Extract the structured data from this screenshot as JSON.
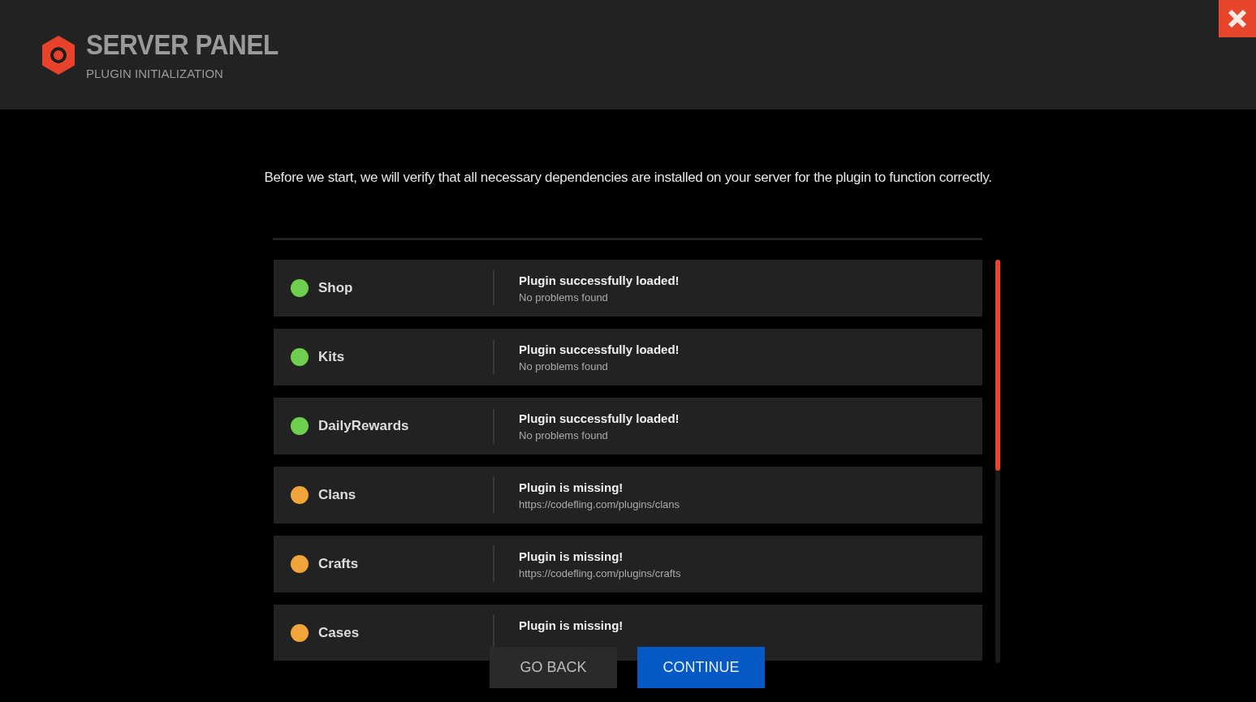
{
  "header": {
    "title": "SERVER PANEL",
    "subtitle": "PLUGIN INITIALIZATION"
  },
  "intro": "Before we start, we will verify that all necessary dependencies are installed on your server for the plugin to function correctly.",
  "plugins": [
    {
      "name": "Shop",
      "color": "#6ecf4f",
      "message": "Plugin successfully loaded!",
      "detail": "No problems found"
    },
    {
      "name": "Kits",
      "color": "#6ecf4f",
      "message": "Plugin successfully loaded!",
      "detail": "No problems found"
    },
    {
      "name": "DailyRewards",
      "color": "#6ecf4f",
      "message": "Plugin successfully loaded!",
      "detail": "No problems found"
    },
    {
      "name": "Clans",
      "color": "#f0a43a",
      "message": "Plugin is missing!",
      "detail": "https://codefling.com/plugins/clans"
    },
    {
      "name": "Crafts",
      "color": "#f0a43a",
      "message": "Plugin is missing!",
      "detail": "https://codefling.com/plugins/crafts"
    },
    {
      "name": "Cases",
      "color": "#f0a43a",
      "message": "Plugin is missing!"
    }
  ],
  "buttons": [
    {
      "label": "GO BACK",
      "kind": "secondary"
    },
    {
      "label": "CONTINUE",
      "kind": "primary"
    }
  ]
}
